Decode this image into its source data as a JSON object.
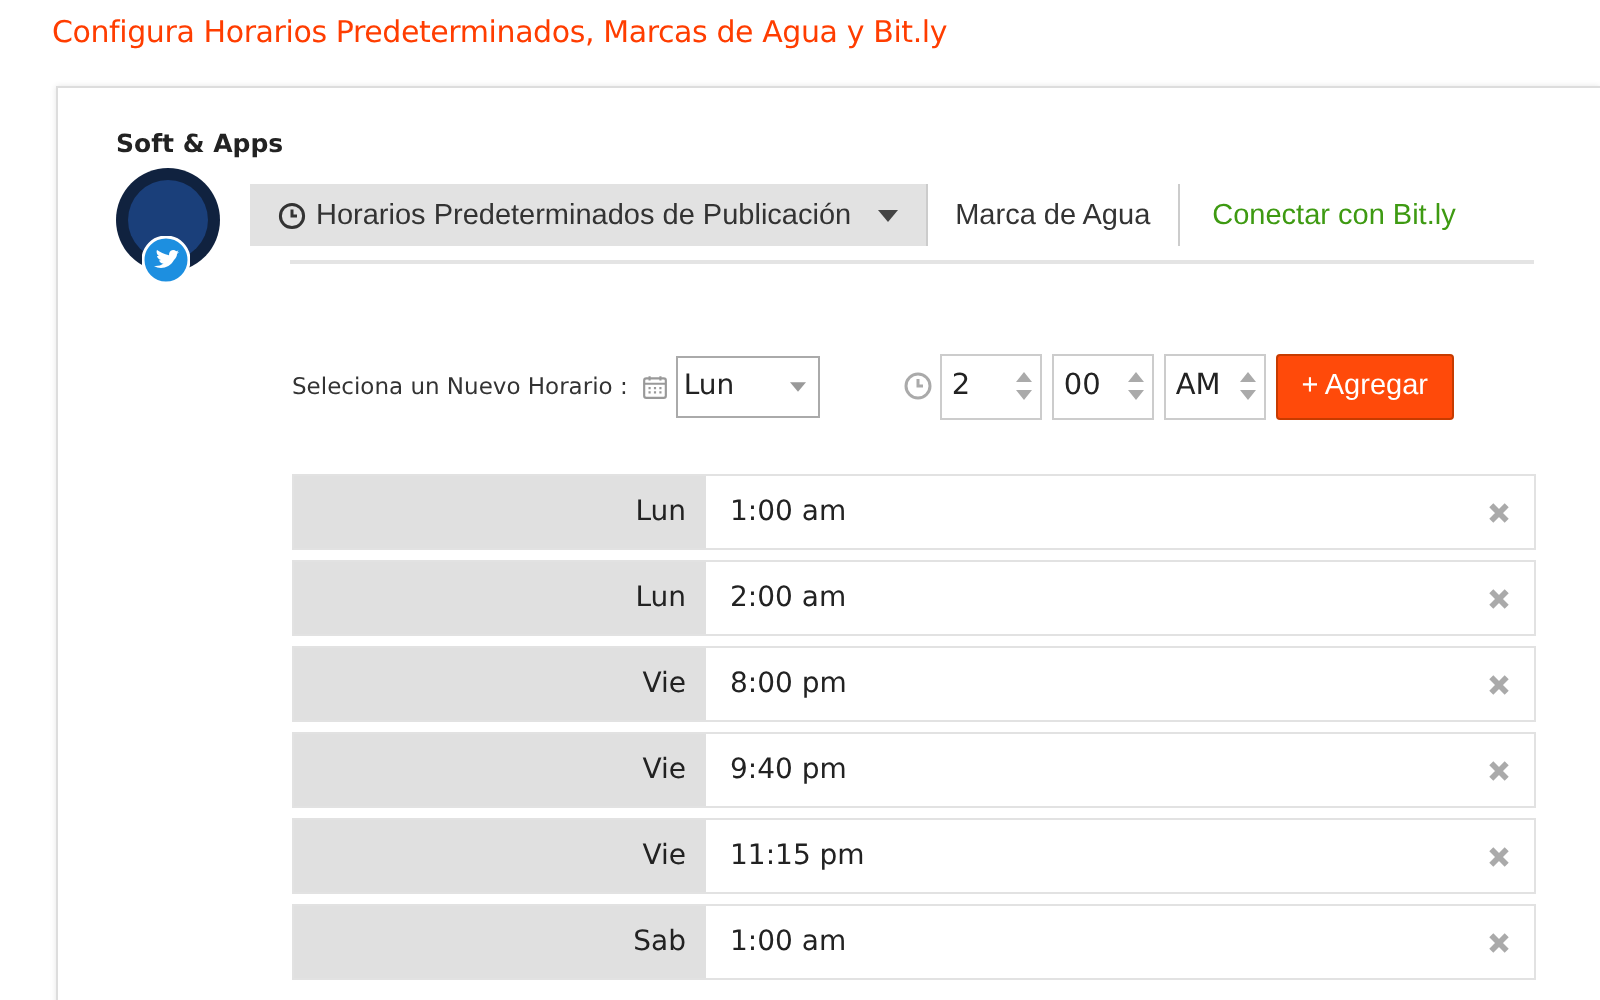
{
  "page_title": "Configura Horarios Predeterminados, Marcas de Agua y Bit.ly",
  "account": {
    "name": "Soft & Apps"
  },
  "tabs": [
    {
      "label": "Horarios Predeterminados de Publicación",
      "kind": "dropdown",
      "selected": true
    },
    {
      "label": "Marca de Agua",
      "kind": "plain",
      "selected": false
    },
    {
      "label": "Conectar con Bit.ly",
      "kind": "link",
      "selected": false
    }
  ],
  "new_schedule": {
    "label": "Seleciona un Nuevo Horario :",
    "day": "Lun",
    "hour": "2",
    "minute": "00",
    "period": "AM",
    "add_button": "+ Agregar"
  },
  "schedules": [
    {
      "day": "Lun",
      "time": "1:00 am"
    },
    {
      "day": "Lun",
      "time": "2:00 am"
    },
    {
      "day": "Vie",
      "time": "8:00 pm"
    },
    {
      "day": "Vie",
      "time": "9:40 pm"
    },
    {
      "day": "Vie",
      "time": "11:15 pm"
    },
    {
      "day": "Sab",
      "time": "1:00 am"
    }
  ]
}
